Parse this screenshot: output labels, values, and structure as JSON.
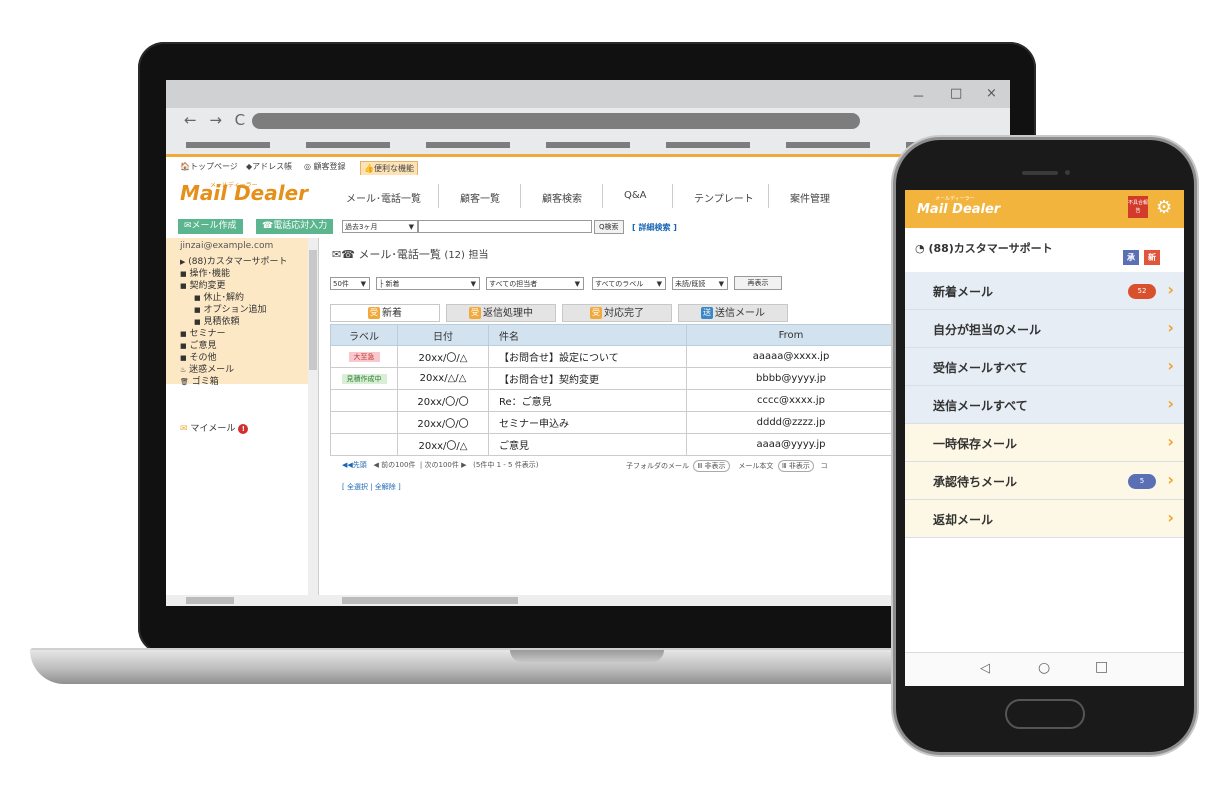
{
  "browser": {
    "window_controls": [
      "－",
      "□",
      "×"
    ],
    "nav_arrows": "← → C"
  },
  "topnav": {
    "items": [
      "🏠トップページ",
      "◆アドレス帳",
      "◎ 顧客登録",
      "👍便利な機能"
    ]
  },
  "logo": {
    "sub": "メールディーラー",
    "text": "Mail Dealer"
  },
  "menu": [
    "メール･電話一覧",
    "顧客一覧",
    "顧客検索",
    "Q&A",
    "テンプレート",
    "案件管理"
  ],
  "toolbar": {
    "compose": "✉メール作成",
    "phone": "☎電話応対入力",
    "period": "過去3ヶ月",
    "period_arrow": "▼",
    "search_btn": "Q検索",
    "detail_search": "[ 詳細検索 ]"
  },
  "sidebar": {
    "email": "jinzai@example.com",
    "items": [
      {
        "icon": "▶",
        "label": "(88)カスタマーサポート",
        "indent": 0
      },
      {
        "icon": "■",
        "label": "操作･機能",
        "indent": 0
      },
      {
        "icon": "■",
        "label": "契約変更",
        "indent": 0
      },
      {
        "icon": "■",
        "label": "休止･解約",
        "indent": 1
      },
      {
        "icon": "■",
        "label": "オプション追加",
        "indent": 1
      },
      {
        "icon": "■",
        "label": "見積依頼",
        "indent": 1
      },
      {
        "icon": "■",
        "label": "セミナー",
        "indent": 0
      },
      {
        "icon": "■",
        "label": "ご意見",
        "indent": 0
      },
      {
        "icon": "■",
        "label": "その他",
        "indent": 0
      },
      {
        "icon": "♨",
        "label": "迷惑メール",
        "indent": 0
      },
      {
        "icon": "🗑",
        "label": "ゴミ箱",
        "indent": 0
      }
    ],
    "mymail": "マイメール",
    "mymail_alert": "!"
  },
  "main": {
    "title_icons": "✉☎",
    "title": "メール･電話一覧",
    "count": "(12)",
    "assign": "担当",
    "filters": {
      "per_page": "50件",
      "status": "├ 新着",
      "assignee": "すべての担当者",
      "label": "すべてのラベル",
      "read": "未読/既読",
      "redisplay": "再表示"
    },
    "tabs": [
      {
        "icon": "受",
        "label": "新着",
        "color": "#f2a93b"
      },
      {
        "icon": "受",
        "label": "返信処理中",
        "color": "#f2a93b"
      },
      {
        "icon": "受",
        "label": "対応完了",
        "color": "#f2a93b"
      },
      {
        "icon": "送",
        "label": "送信メール",
        "color": "#3a86c6"
      }
    ],
    "columns": [
      "ラベル",
      "日付",
      "件名",
      "From"
    ],
    "rows": [
      {
        "label": "大至急",
        "label_bg": "#f7c9cf",
        "label_fg": "#c0392b",
        "date": "20xx/〇/△",
        "subject": "【お問合せ】設定について",
        "from": "aaaaa@xxxx.jp"
      },
      {
        "label": "見積作成中",
        "label_bg": "#d8efd6",
        "label_fg": "#2e7d32",
        "date": "20xx/△/△",
        "subject": "【お問合せ】契約変更",
        "from": "bbbb@yyyy.jp"
      },
      {
        "label": "",
        "label_bg": "",
        "label_fg": "",
        "date": "20xx/〇/〇",
        "subject": "Re：ご意見",
        "from": "cccc@xxxx.jp"
      },
      {
        "label": "",
        "label_bg": "",
        "label_fg": "",
        "date": "20xx/〇/〇",
        "subject": "セミナー申込み",
        "from": "dddd@zzzz.jp"
      },
      {
        "label": "",
        "label_bg": "",
        "label_fg": "",
        "date": "20xx/〇/△",
        "subject": "ご意見",
        "from": "aaaa@yyyy.jp"
      }
    ],
    "pager": {
      "first": "◀◀先頭",
      "prev": "◀ 前の100件",
      "next": "次の100件 ▶",
      "summary": "(5件中  1 - 5 件表示)",
      "subfolder": "子フォルダのメール",
      "subfolder_toggle": "Ⅲ 非表示",
      "body": "メール本文",
      "body_toggle": "Ⅲ 非表示",
      "cut": "コ",
      "select_all": "[ 全選択",
      "deselect_all": "全解除 ]"
    }
  },
  "phone": {
    "logo": "Mail Dealer",
    "logo_sub": "メールディーラー",
    "report_badge": "不具合報告",
    "account": "(88)カスタマーサポート",
    "account_tags": [
      {
        "text": "承",
        "color": "#5b6fb5"
      },
      {
        "text": "新",
        "color": "#e0553b"
      }
    ],
    "items": [
      {
        "label": "新着メール",
        "count": "52",
        "count_color": "#d9512c",
        "bg": "#e7edf5"
      },
      {
        "label": "自分が担当のメール",
        "count": "",
        "count_color": "",
        "bg": "#e7edf5"
      },
      {
        "label": "受信メールすべて",
        "count": "",
        "count_color": "",
        "bg": "#e7edf5"
      },
      {
        "label": "送信メールすべて",
        "count": "",
        "count_color": "",
        "bg": "#e7edf5"
      },
      {
        "label": "一時保存メール",
        "count": "",
        "count_color": "",
        "bg": "#fdf7e5"
      },
      {
        "label": "承認待ちメール",
        "count": "5",
        "count_color": "#5b6fb5",
        "bg": "#fdf7e5"
      },
      {
        "label": "返却メール",
        "count": "",
        "count_color": "",
        "bg": "#fdf7e5"
      }
    ],
    "chevron": "›",
    "nav": [
      "◁",
      "○",
      "□"
    ]
  }
}
